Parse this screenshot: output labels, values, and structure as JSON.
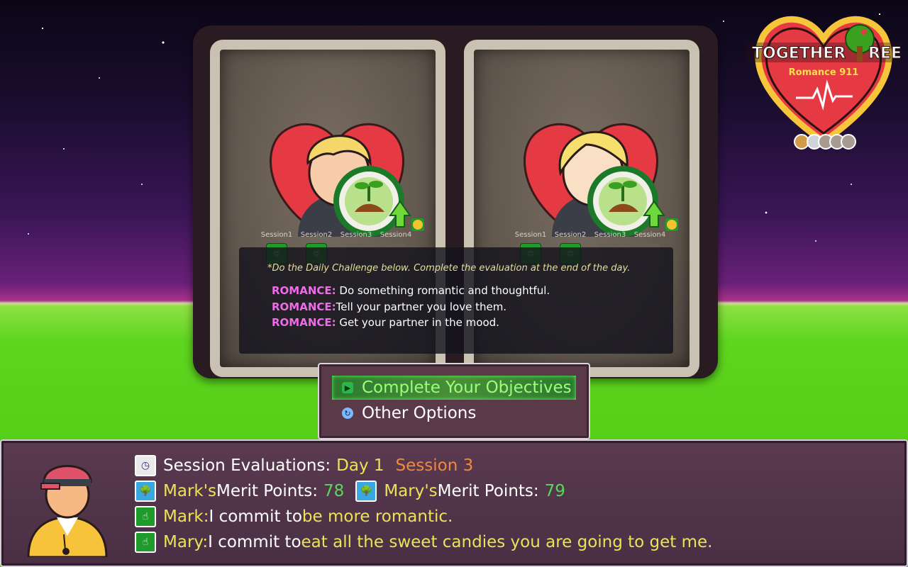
{
  "partners": [
    {
      "hair_color": "#f5d66a",
      "sessions": [
        {
          "label": "Session1",
          "status": "done"
        },
        {
          "label": "Session2",
          "status": "done"
        },
        {
          "label": "Session3",
          "status": "pending"
        },
        {
          "label": "Session4",
          "status": "pending"
        }
      ]
    },
    {
      "hair_color": "#f7df6f",
      "sessions": [
        {
          "label": "Session1",
          "status": "done"
        },
        {
          "label": "Session2",
          "status": "done"
        },
        {
          "label": "Session3",
          "status": "pending"
        },
        {
          "label": "Session4",
          "status": "pending"
        }
      ]
    }
  ],
  "challenge": {
    "note": "*Do the Daily Challenge below. Complete the evaluation at the end of the day.",
    "items": [
      {
        "category": "ROMANCE:",
        "text": " Do something romantic and thoughtful."
      },
      {
        "category": "ROMANCE:",
        "text": "Tell your partner you love them."
      },
      {
        "category": "ROMANCE:",
        "text": " Get your partner in the mood."
      }
    ]
  },
  "menu": {
    "complete_objectives": "Complete Your Objectives",
    "other_options": "Other Options"
  },
  "logo": {
    "title": "Together Tree",
    "subtitle": "Romance 911"
  },
  "dialog": {
    "session_eval_label": "Session Evaluations:",
    "day": "Day 1",
    "session": "Session 3",
    "mark_name": "Mark's",
    "mary_name": "Mary's",
    "merit_label": " Merit Points:",
    "mark_points": "78",
    "mary_points": "79",
    "mark_speaker": "Mark:",
    "mary_speaker": "Mary:",
    "commit_prefix": " I commit to ",
    "mark_commit": "be more romantic.",
    "mary_commit": "eat all the sweet candies you are going to get me."
  },
  "colors": {
    "accent_pink": "#ef6be9",
    "speaker_yellow": "#e9e35a",
    "session_orange": "#f08a3e",
    "points_green": "#58d85a"
  },
  "icons": [
    "clock-icon",
    "tree-icon",
    "pointing-hand-icon",
    "heart-eyes-emoji-icon",
    "sprout-growth-icon"
  ]
}
